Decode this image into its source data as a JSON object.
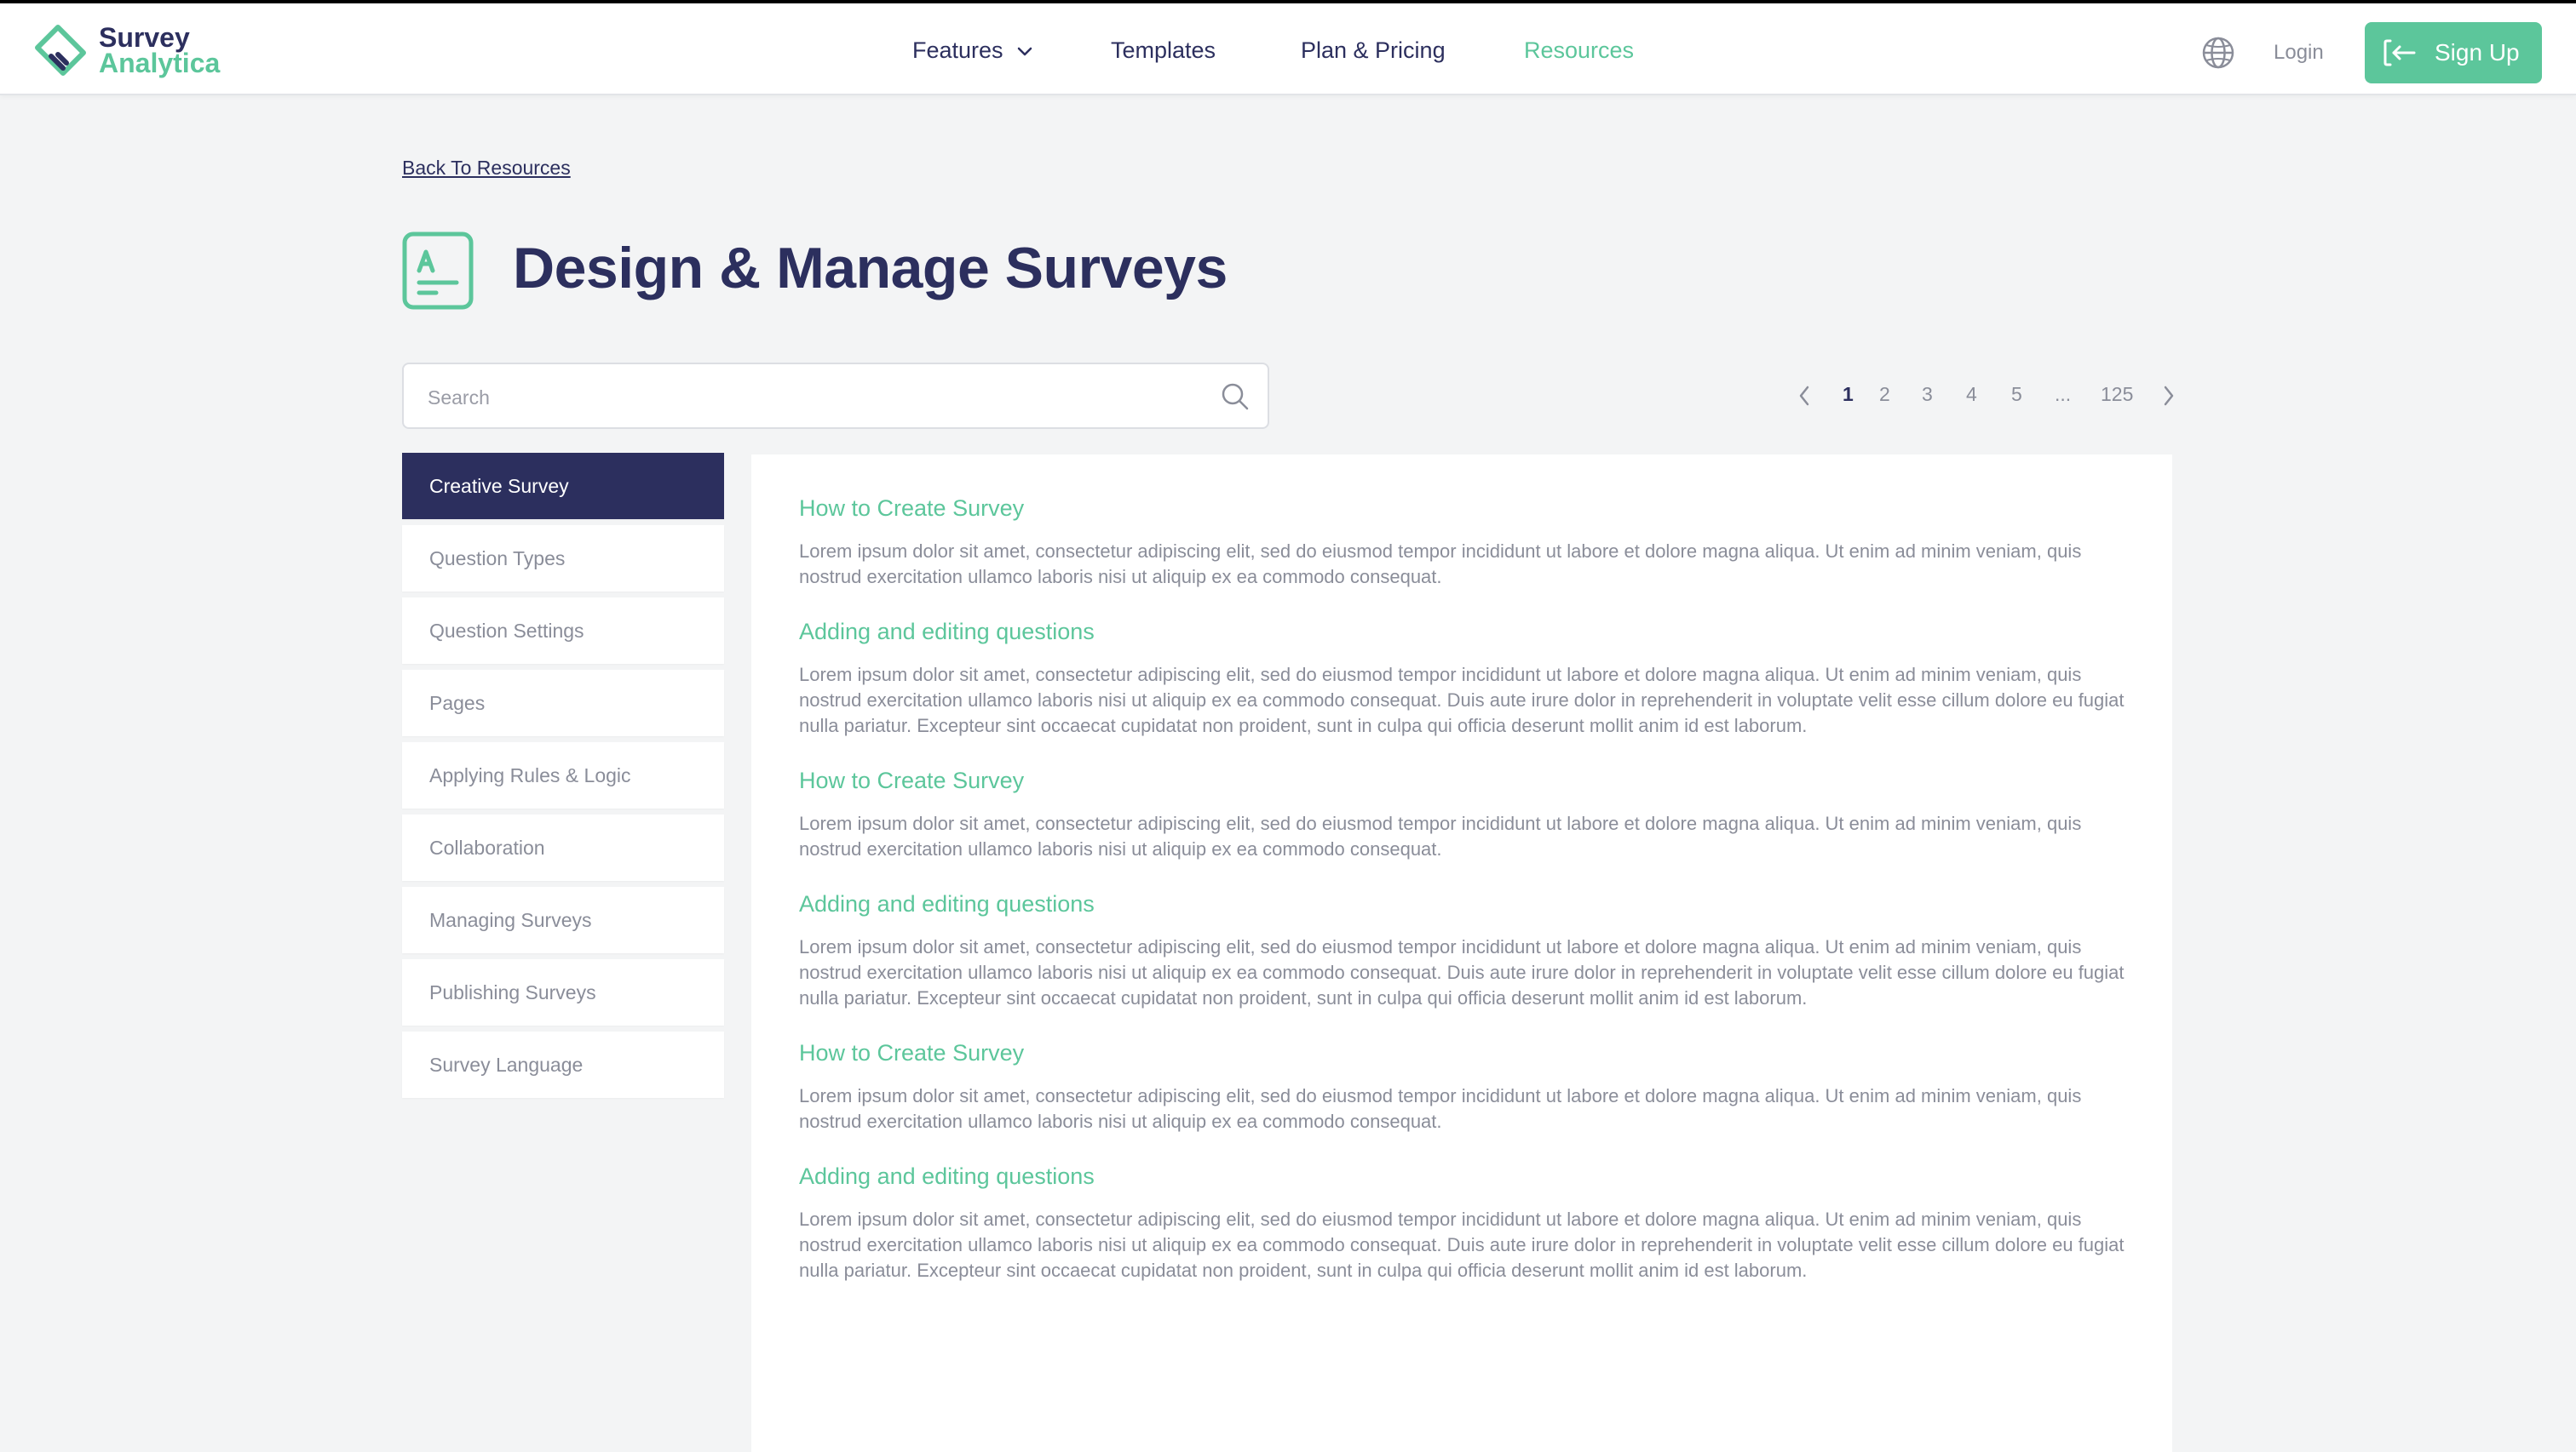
{
  "brand": {
    "line1": "Survey",
    "line2": "Analytica",
    "primary_color": "#2c2f5e",
    "accent_color": "#5cc69b"
  },
  "nav": {
    "features": "Features",
    "templates": "Templates",
    "pricing": "Plan & Pricing",
    "resources": "Resources"
  },
  "header_actions": {
    "login": "Login",
    "signup": "Sign Up",
    "globe_icon": "globe-icon",
    "signup_icon": "login-arrow-icon"
  },
  "back_link": "Back To Resources",
  "page_title": "Design & Manage Surveys",
  "search": {
    "placeholder": "Search",
    "value": ""
  },
  "pagination": {
    "pages": [
      "1",
      "2",
      "3",
      "4",
      "5",
      "...",
      "125"
    ],
    "current": "1"
  },
  "sidebar": {
    "items": [
      {
        "label": "Creative Survey",
        "active": true
      },
      {
        "label": "Question Types",
        "active": false
      },
      {
        "label": "Question Settings",
        "active": false
      },
      {
        "label": "Pages",
        "active": false
      },
      {
        "label": "Applying Rules & Logic",
        "active": false
      },
      {
        "label": "Collaboration",
        "active": false
      },
      {
        "label": "Managing Surveys",
        "active": false
      },
      {
        "label": "Publishing Surveys",
        "active": false
      },
      {
        "label": "Survey Language",
        "active": false
      }
    ]
  },
  "articles": [
    {
      "title": "How to Create Survey",
      "body": "Lorem ipsum dolor sit amet, consectetur adipiscing elit, sed do eiusmod tempor incididunt ut labore et dolore magna aliqua. Ut enim ad minim veniam, quis nostrud exercitation ullamco laboris nisi ut aliquip ex ea commodo consequat."
    },
    {
      "title": "Adding and editing questions",
      "body": "Lorem ipsum dolor sit amet, consectetur adipiscing elit, sed do eiusmod tempor incididunt ut labore et dolore magna aliqua. Ut enim ad minim veniam, quis nostrud exercitation ullamco laboris nisi ut aliquip ex ea commodo consequat. Duis aute irure dolor in reprehenderit in voluptate velit esse cillum dolore eu fugiat nulla pariatur. Excepteur sint occaecat cupidatat non proident, sunt in culpa qui officia deserunt mollit anim id est laborum."
    },
    {
      "title": "How to Create Survey",
      "body": "Lorem ipsum dolor sit amet, consectetur adipiscing elit, sed do eiusmod tempor incididunt ut labore et dolore magna aliqua. Ut enim ad minim veniam, quis nostrud exercitation ullamco laboris nisi ut aliquip ex ea commodo consequat."
    },
    {
      "title": "Adding and editing questions",
      "body": "Lorem ipsum dolor sit amet, consectetur adipiscing elit, sed do eiusmod tempor incididunt ut labore et dolore magna aliqua. Ut enim ad minim veniam, quis nostrud exercitation ullamco laboris nisi ut aliquip ex ea commodo consequat. Duis aute irure dolor in reprehenderit in voluptate velit esse cillum dolore eu fugiat nulla pariatur. Excepteur sint occaecat cupidatat non proident, sunt in culpa qui officia deserunt mollit anim id est laborum."
    },
    {
      "title": "How to Create Survey",
      "body": "Lorem ipsum dolor sit amet, consectetur adipiscing elit, sed do eiusmod tempor incididunt ut labore et dolore magna aliqua. Ut enim ad minim veniam, quis nostrud exercitation ullamco laboris nisi ut aliquip ex ea commodo consequat."
    },
    {
      "title": "Adding and editing questions",
      "body": "Lorem ipsum dolor sit amet, consectetur adipiscing elit, sed do eiusmod tempor incididunt ut labore et dolore magna aliqua. Ut enim ad minim veniam, quis nostrud exercitation ullamco laboris nisi ut aliquip ex ea commodo consequat. Duis aute irure dolor in reprehenderit in voluptate velit esse cillum dolore eu fugiat nulla pariatur. Excepteur sint occaecat cupidatat non proident, sunt in culpa qui officia deserunt mollit anim id est laborum."
    }
  ]
}
